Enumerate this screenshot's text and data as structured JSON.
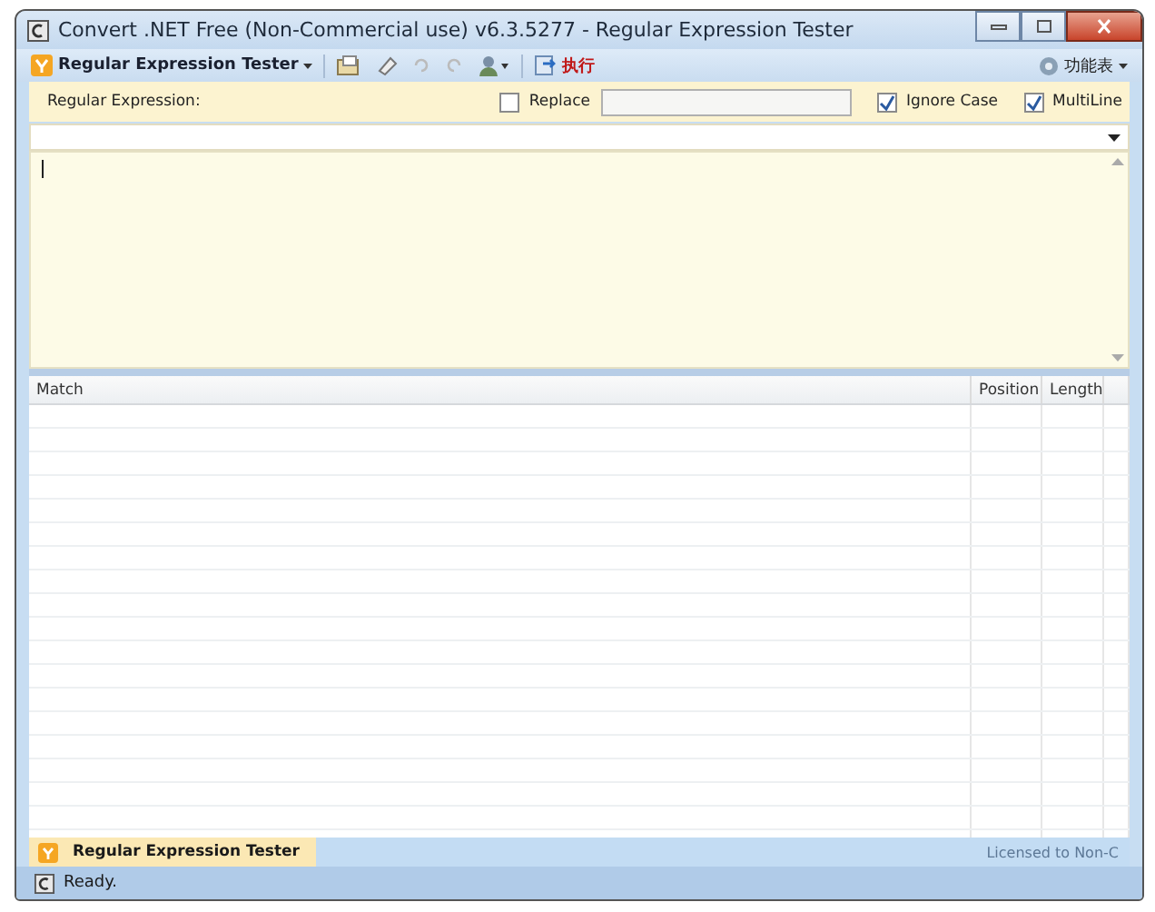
{
  "window": {
    "title": "Convert .NET Free (Non-Commercial use) v6.3.5277 - Regular Expression Tester"
  },
  "toolbar": {
    "tool_menu": "Regular Expression Tester",
    "run_button": "执行",
    "feature_menu": "功能表"
  },
  "options": {
    "regex_label": "Regular Expression:",
    "replace": {
      "label": "Replace",
      "checked": false
    },
    "ignore_case": {
      "label": "Ignore Case",
      "checked": true
    },
    "multiline": {
      "label": "MultiLine",
      "checked": true
    }
  },
  "table": {
    "columns": [
      "Match",
      "Position",
      "Length"
    ]
  },
  "tabs": [
    {
      "label": "Regular Expression Tester",
      "selected": true
    }
  ],
  "license_text": "Licensed to Non-C",
  "status_bar": "Ready."
}
